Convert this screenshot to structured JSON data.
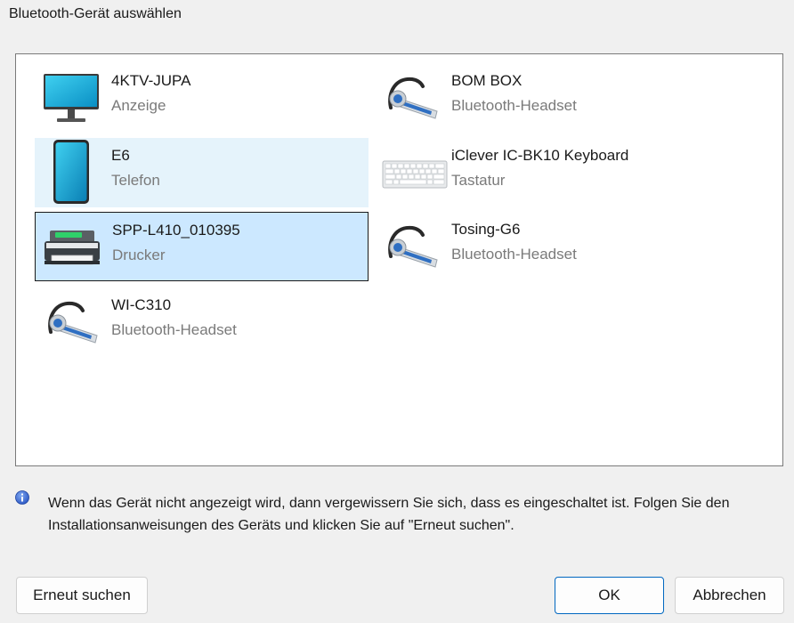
{
  "window": {
    "title": "Bluetooth-Gerät auswählen"
  },
  "devices": [
    {
      "name": "4KTV-JUPA",
      "type": "Anzeige",
      "icon": "monitor-icon"
    },
    {
      "name": "BOM BOX",
      "type": "Bluetooth-Headset",
      "icon": "headset-icon"
    },
    {
      "name": "E6",
      "type": "Telefon",
      "icon": "phone-icon",
      "state": "hover"
    },
    {
      "name": "iClever IC-BK10 Keyboard",
      "type": "Tastatur",
      "icon": "keyboard-icon"
    },
    {
      "name": "SPP-L410_010395",
      "type": "Drucker",
      "icon": "printer-icon",
      "state": "selected"
    },
    {
      "name": "Tosing-G6",
      "type": "Bluetooth-Headset",
      "icon": "headset-icon"
    },
    {
      "name": "WI-C310",
      "type": "Bluetooth-Headset",
      "icon": "headset-icon"
    }
  ],
  "info": {
    "icon": "info-icon",
    "text": "Wenn das Gerät nicht angezeigt wird, dann vergewissern Sie sich, dass es eingeschaltet ist. Folgen Sie den Installationsanweisungen des Geräts und klicken Sie auf \"Erneut suchen\"."
  },
  "buttons": {
    "rescan": "Erneut suchen",
    "ok": "OK",
    "cancel": "Abbrechen"
  },
  "colors": {
    "hover": "#e5f3fb",
    "selected": "#cce8ff",
    "accent": "#0067c0"
  }
}
